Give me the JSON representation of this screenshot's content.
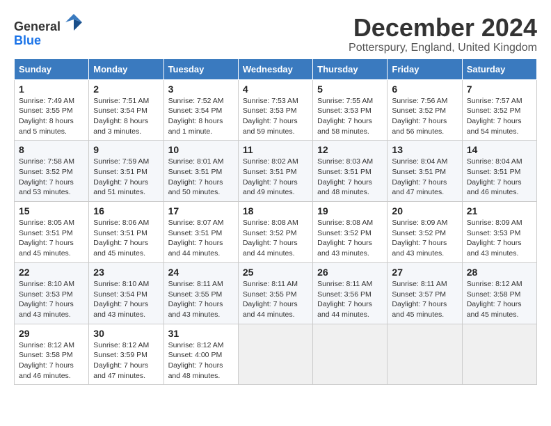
{
  "header": {
    "logo_general": "General",
    "logo_blue": "Blue",
    "title": "December 2024",
    "subtitle": "Potterspury, England, United Kingdom"
  },
  "columns": [
    "Sunday",
    "Monday",
    "Tuesday",
    "Wednesday",
    "Thursday",
    "Friday",
    "Saturday"
  ],
  "weeks": [
    [
      {
        "day": "1",
        "detail": "Sunrise: 7:49 AM\nSunset: 3:55 PM\nDaylight: 8 hours\nand 5 minutes."
      },
      {
        "day": "2",
        "detail": "Sunrise: 7:51 AM\nSunset: 3:54 PM\nDaylight: 8 hours\nand 3 minutes."
      },
      {
        "day": "3",
        "detail": "Sunrise: 7:52 AM\nSunset: 3:54 PM\nDaylight: 8 hours\nand 1 minute."
      },
      {
        "day": "4",
        "detail": "Sunrise: 7:53 AM\nSunset: 3:53 PM\nDaylight: 7 hours\nand 59 minutes."
      },
      {
        "day": "5",
        "detail": "Sunrise: 7:55 AM\nSunset: 3:53 PM\nDaylight: 7 hours\nand 58 minutes."
      },
      {
        "day": "6",
        "detail": "Sunrise: 7:56 AM\nSunset: 3:52 PM\nDaylight: 7 hours\nand 56 minutes."
      },
      {
        "day": "7",
        "detail": "Sunrise: 7:57 AM\nSunset: 3:52 PM\nDaylight: 7 hours\nand 54 minutes."
      }
    ],
    [
      {
        "day": "8",
        "detail": "Sunrise: 7:58 AM\nSunset: 3:52 PM\nDaylight: 7 hours\nand 53 minutes."
      },
      {
        "day": "9",
        "detail": "Sunrise: 7:59 AM\nSunset: 3:51 PM\nDaylight: 7 hours\nand 51 minutes."
      },
      {
        "day": "10",
        "detail": "Sunrise: 8:01 AM\nSunset: 3:51 PM\nDaylight: 7 hours\nand 50 minutes."
      },
      {
        "day": "11",
        "detail": "Sunrise: 8:02 AM\nSunset: 3:51 PM\nDaylight: 7 hours\nand 49 minutes."
      },
      {
        "day": "12",
        "detail": "Sunrise: 8:03 AM\nSunset: 3:51 PM\nDaylight: 7 hours\nand 48 minutes."
      },
      {
        "day": "13",
        "detail": "Sunrise: 8:04 AM\nSunset: 3:51 PM\nDaylight: 7 hours\nand 47 minutes."
      },
      {
        "day": "14",
        "detail": "Sunrise: 8:04 AM\nSunset: 3:51 PM\nDaylight: 7 hours\nand 46 minutes."
      }
    ],
    [
      {
        "day": "15",
        "detail": "Sunrise: 8:05 AM\nSunset: 3:51 PM\nDaylight: 7 hours\nand 45 minutes."
      },
      {
        "day": "16",
        "detail": "Sunrise: 8:06 AM\nSunset: 3:51 PM\nDaylight: 7 hours\nand 45 minutes."
      },
      {
        "day": "17",
        "detail": "Sunrise: 8:07 AM\nSunset: 3:51 PM\nDaylight: 7 hours\nand 44 minutes."
      },
      {
        "day": "18",
        "detail": "Sunrise: 8:08 AM\nSunset: 3:52 PM\nDaylight: 7 hours\nand 44 minutes."
      },
      {
        "day": "19",
        "detail": "Sunrise: 8:08 AM\nSunset: 3:52 PM\nDaylight: 7 hours\nand 43 minutes."
      },
      {
        "day": "20",
        "detail": "Sunrise: 8:09 AM\nSunset: 3:52 PM\nDaylight: 7 hours\nand 43 minutes."
      },
      {
        "day": "21",
        "detail": "Sunrise: 8:09 AM\nSunset: 3:53 PM\nDaylight: 7 hours\nand 43 minutes."
      }
    ],
    [
      {
        "day": "22",
        "detail": "Sunrise: 8:10 AM\nSunset: 3:53 PM\nDaylight: 7 hours\nand 43 minutes."
      },
      {
        "day": "23",
        "detail": "Sunrise: 8:10 AM\nSunset: 3:54 PM\nDaylight: 7 hours\nand 43 minutes."
      },
      {
        "day": "24",
        "detail": "Sunrise: 8:11 AM\nSunset: 3:55 PM\nDaylight: 7 hours\nand 43 minutes."
      },
      {
        "day": "25",
        "detail": "Sunrise: 8:11 AM\nSunset: 3:55 PM\nDaylight: 7 hours\nand 44 minutes."
      },
      {
        "day": "26",
        "detail": "Sunrise: 8:11 AM\nSunset: 3:56 PM\nDaylight: 7 hours\nand 44 minutes."
      },
      {
        "day": "27",
        "detail": "Sunrise: 8:11 AM\nSunset: 3:57 PM\nDaylight: 7 hours\nand 45 minutes."
      },
      {
        "day": "28",
        "detail": "Sunrise: 8:12 AM\nSunset: 3:58 PM\nDaylight: 7 hours\nand 45 minutes."
      }
    ],
    [
      {
        "day": "29",
        "detail": "Sunrise: 8:12 AM\nSunset: 3:58 PM\nDaylight: 7 hours\nand 46 minutes."
      },
      {
        "day": "30",
        "detail": "Sunrise: 8:12 AM\nSunset: 3:59 PM\nDaylight: 7 hours\nand 47 minutes."
      },
      {
        "day": "31",
        "detail": "Sunrise: 8:12 AM\nSunset: 4:00 PM\nDaylight: 7 hours\nand 48 minutes."
      },
      {
        "day": "",
        "detail": ""
      },
      {
        "day": "",
        "detail": ""
      },
      {
        "day": "",
        "detail": ""
      },
      {
        "day": "",
        "detail": ""
      }
    ]
  ]
}
